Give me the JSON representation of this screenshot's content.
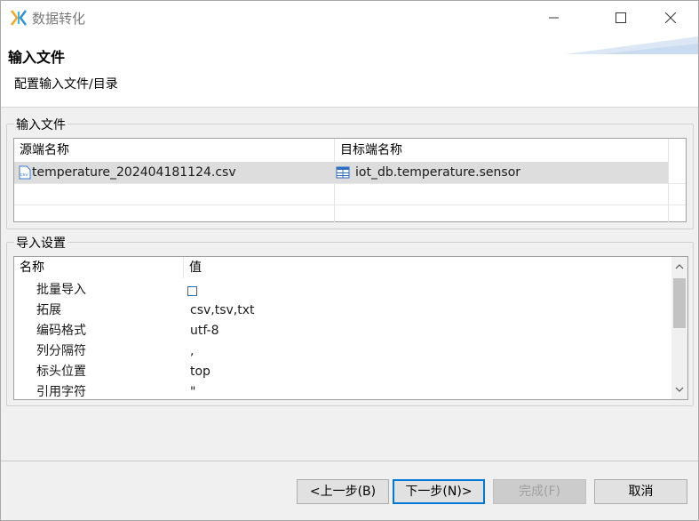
{
  "window": {
    "title": "数据转化"
  },
  "header": {
    "title": "输入文件",
    "description": "配置输入文件/目录"
  },
  "input_files": {
    "group_label": "输入文件",
    "columns": [
      "源端名称",
      "目标端名称"
    ],
    "rows": [
      {
        "source": "temperature_202404181124.csv",
        "source_icon": "csv-file-icon",
        "source_icon_text": "csv",
        "target": "iot_db.temperature.sensor",
        "target_icon": "table-icon",
        "selected": true
      }
    ]
  },
  "import_settings": {
    "group_label": "导入设置",
    "columns": [
      "名称",
      "值"
    ],
    "rows": [
      {
        "name": "批量导入",
        "value": "",
        "type": "checkbox",
        "checked": false
      },
      {
        "name": "拓展",
        "value": "csv,tsv,txt"
      },
      {
        "name": "编码格式",
        "value": "utf-8"
      },
      {
        "name": "列分隔符",
        "value": ","
      },
      {
        "name": "标头位置",
        "value": "top"
      },
      {
        "name": "引用字符",
        "value": "\""
      }
    ]
  },
  "buttons": {
    "back": "<上一步(B)",
    "next": "下一步(N)>",
    "finish": "完成(F)",
    "cancel": "取消"
  },
  "colors": {
    "accent": "#0078d7",
    "selected_row": "#dddddd"
  }
}
